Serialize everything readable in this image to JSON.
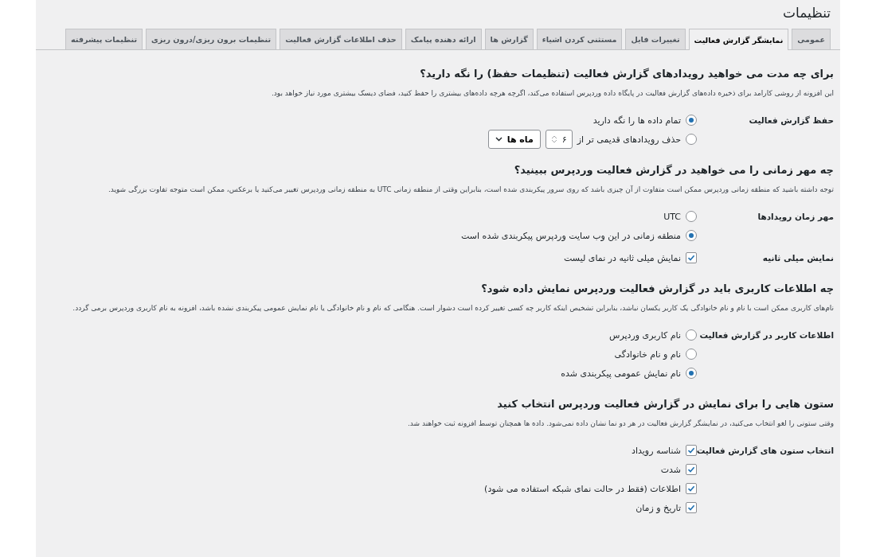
{
  "page_title": "تنظیمات",
  "tabs": [
    {
      "label": "عمومی",
      "selected": false
    },
    {
      "label": "نمایشگر گزارش فعالیت",
      "selected": true
    },
    {
      "label": "تغییرات فایل",
      "selected": false
    },
    {
      "label": "مستثنی کردن اشیاء",
      "selected": false
    },
    {
      "label": "گزارش ها",
      "selected": false
    },
    {
      "label": "ارائه دهنده پیامک",
      "selected": false
    },
    {
      "label": "حذف اطلاعات گزارش فعالیت",
      "selected": false
    },
    {
      "label": "تنظیمات برون ریزی/درون ریزی",
      "selected": false
    },
    {
      "label": "تنظیمات پیشرفته",
      "selected": false
    }
  ],
  "sections": [
    {
      "heading": "برای چه مدت می خواهید رویدادهای گزارش فعالیت (تنظیمات حفظ) را نگه دارید؟",
      "description": "این افزونه از روشی کارامد برای ذخیره داده‌های گزارش فعالیت در پایگاه داده وردپرس استفاده می‌کند، اگرچه هرچه داده‌های بیشتری را حفظ کنید، فضای دیسک بیشتری مورد نیاز خواهد بود.",
      "rows": [
        {
          "label": "حفظ گزارش فعالیت",
          "options": [
            {
              "kind": "radio",
              "label": "تمام داده ها را نگه دارید",
              "selected": true
            },
            {
              "kind": "radio_period",
              "label": "حذف رویدادهای قدیمی تر از",
              "selected": false,
              "number": "۶",
              "unit": "ماه ها"
            }
          ]
        }
      ]
    },
    {
      "heading": "چه مهر زمانی را می خواهید در گزارش فعالیت وردپرس ببینید؟",
      "description": "توجه داشته باشید که منطقه زمانی وردپرس ممکن است متفاوت از آن چیزی باشد که روی سرور پیکربندی شده است، بنابراین وقتی از منطقه زمانی UTC به منطقه زمانی وردپرس تغییر می‌کنید یا برعکس، ممکن است متوجه تفاوت بزرگی شوید.",
      "rows": [
        {
          "label": "مهر زمان رویدادها",
          "options": [
            {
              "kind": "radio",
              "label": "UTC",
              "selected": false
            },
            {
              "kind": "radio",
              "label": "منطقه زمانی در این وب سایت وردپرس پیکربندی شده است",
              "selected": true
            }
          ]
        },
        {
          "label": "نمایش میلی ثانیه",
          "options": [
            {
              "kind": "checkbox",
              "label": "نمایش میلی ثانیه در نمای لیست",
              "checked": true
            }
          ]
        }
      ]
    },
    {
      "heading": "چه اطلاعات کاربری باید در گزارش فعالیت وردپرس نمایش داده شود؟",
      "description": "نام‌های کاربری ممکن است با نام و نام خانوادگی یک کاربر یکسان نباشد، بنابراین تشخیص اینکه کاربر چه کسی تغییر کرده است دشوار است. هنگامی که نام و نام خانوادگی یا نام نمایش عمومی پیکربندی نشده باشد، افزونه به نام کاربری وردپرس برمی گردد.",
      "rows": [
        {
          "label": "اطلاعات کاربر در گزارش فعالیت",
          "options": [
            {
              "kind": "radio",
              "label": "نام کاربری وردپرس",
              "selected": false
            },
            {
              "kind": "radio",
              "label": "نام و نام خانوادگی",
              "selected": false
            },
            {
              "kind": "radio",
              "label": "نام نمایش عمومی پیکربندی شده",
              "selected": true
            }
          ]
        }
      ]
    },
    {
      "heading": "ستون هایی را برای نمایش در گزارش فعالیت وردپرس انتخاب کنید",
      "description": "وقتی ستونی را لغو انتخاب می‌کنید، در نمایشگر گزارش فعالیت در هر دو نما نشان داده نمی‌شود. داده ها همچنان توسط افزونه ثبت خواهند شد.",
      "rows": [
        {
          "label": "انتخاب ستون های گزارش فعالیت",
          "options": [
            {
              "kind": "checkbox",
              "label": "شناسه رویداد",
              "checked": true
            },
            {
              "kind": "checkbox",
              "label": "شدت",
              "checked": true
            },
            {
              "kind": "checkbox",
              "label": "اطلاعات (فقط در حالت نمای شبکه استفاده می شود)",
              "checked": true
            },
            {
              "kind": "checkbox",
              "label": "تاریخ و زمان",
              "checked": true
            }
          ]
        }
      ]
    }
  ]
}
